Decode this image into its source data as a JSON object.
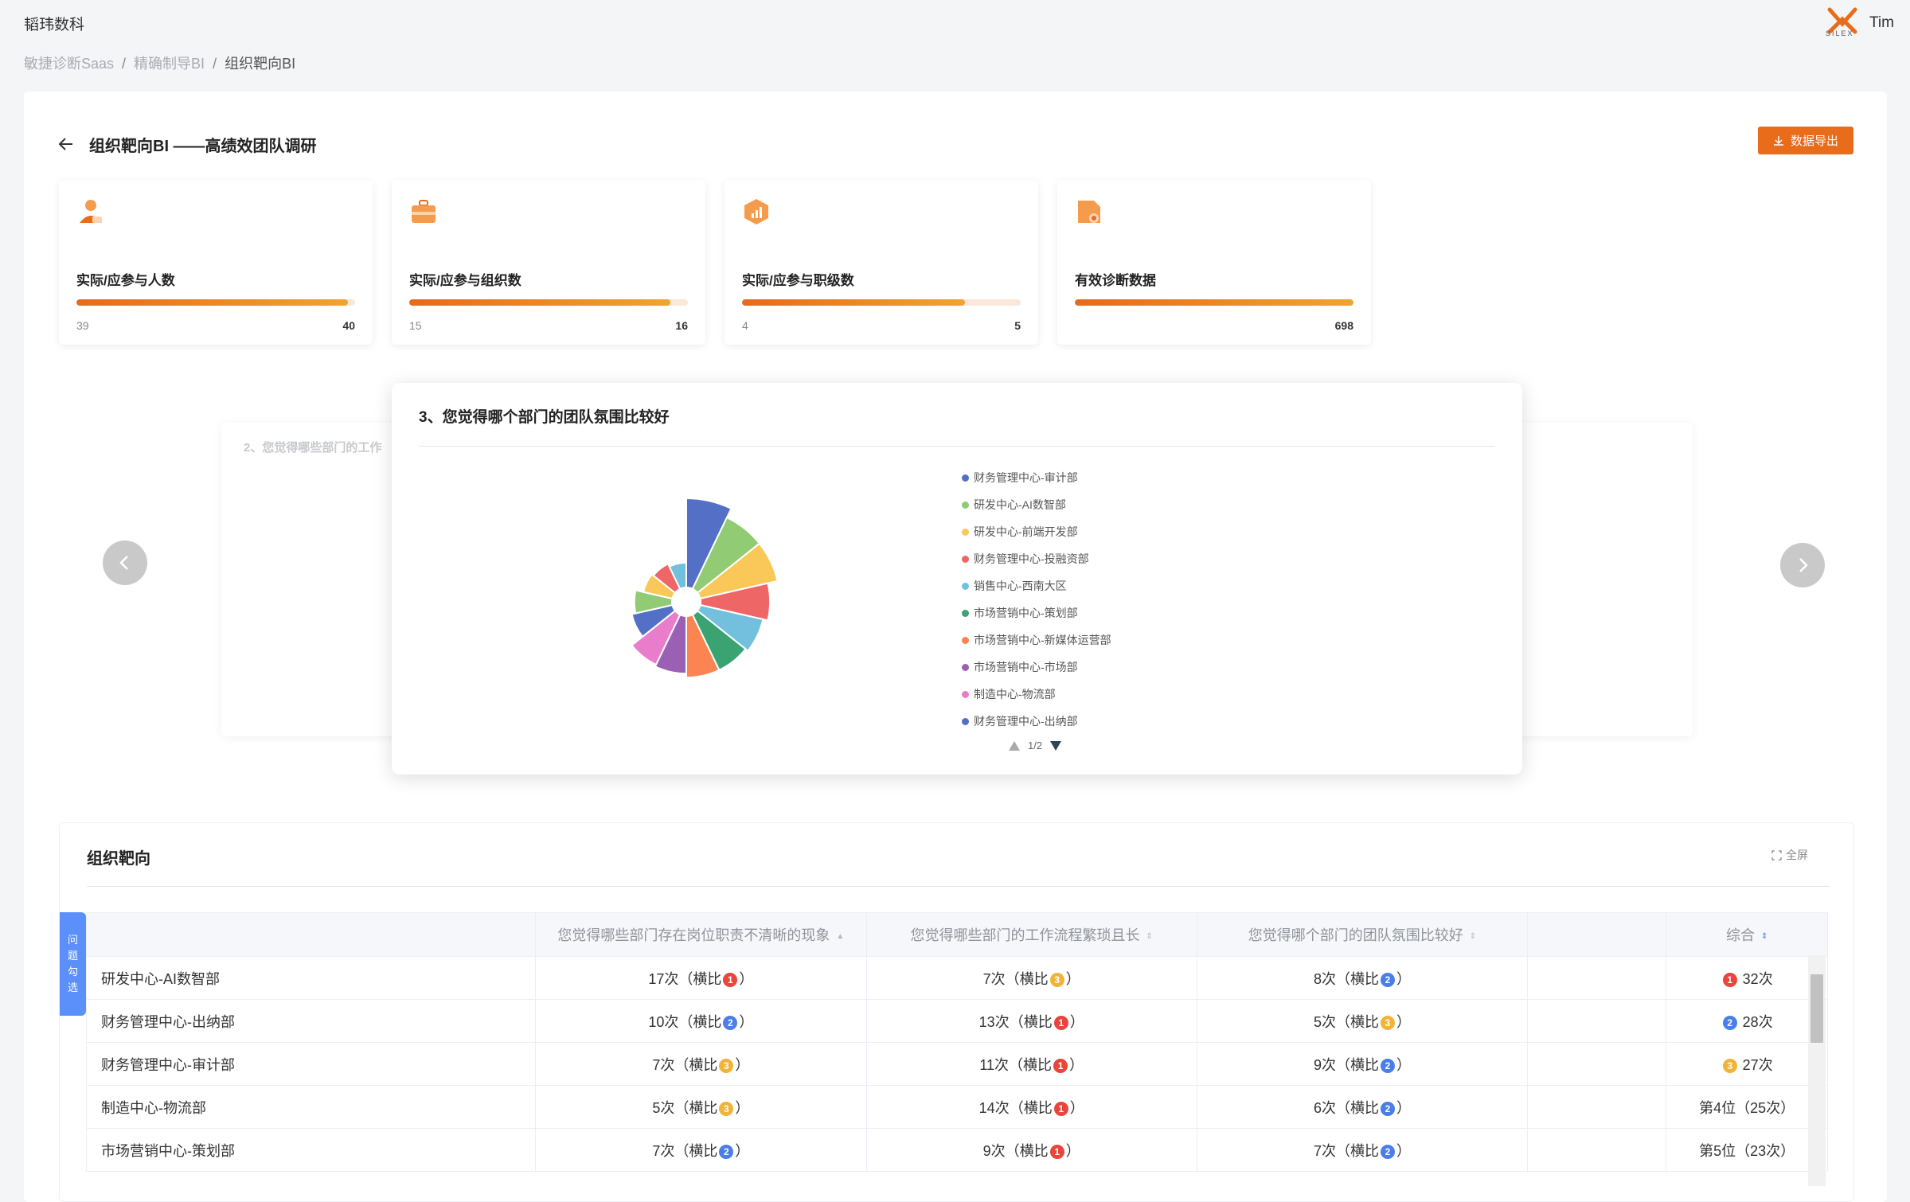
{
  "header": {
    "brand": "韬玮数科",
    "breadcrumb": [
      "敏捷诊断Saas",
      "精确制导BI",
      "组织靶向BI"
    ],
    "logo_text": "SILEX",
    "user_name": "Tim"
  },
  "page": {
    "title": "组织靶向BI ——高绩效团队调研",
    "export_label": "数据导出"
  },
  "stats": [
    {
      "label": "实际/应参与人数",
      "actual": "39",
      "total": "40",
      "progress": 0.975,
      "icon": "user-icon"
    },
    {
      "label": "实际/应参与组织数",
      "actual": "15",
      "total": "16",
      "progress": 0.9375,
      "icon": "briefcase-icon"
    },
    {
      "label": "实际/应参与职级数",
      "actual": "4",
      "total": "5",
      "progress": 0.8,
      "icon": "level-icon"
    },
    {
      "label": "有效诊断数据",
      "actual": "",
      "total": "698",
      "progress": 1.0,
      "icon": "data-icon"
    }
  ],
  "carousel": {
    "back_card_title": "2、您觉得哪些部门的工作",
    "main_card_title": "3、您觉得哪个部门的团队氛围比较好",
    "pager": "1/2"
  },
  "chart_data": {
    "type": "pie",
    "variant": "rose",
    "series": [
      {
        "name": "财务管理中心-审计部",
        "color": "#5470c6"
      },
      {
        "name": "研发中心-AI数智部",
        "color": "#91cc75"
      },
      {
        "name": "研发中心-前端开发部",
        "color": "#fac858"
      },
      {
        "name": "财务管理中心-投融资部",
        "color": "#ee6666"
      },
      {
        "name": "销售中心-西南大区",
        "color": "#73c0de"
      },
      {
        "name": "市场营销中心-策划部",
        "color": "#3ba272"
      },
      {
        "name": "市场营销中心-新媒体运营部",
        "color": "#fc8452"
      },
      {
        "name": "市场营销中心-市场部",
        "color": "#9a60b4"
      },
      {
        "name": "制造中心-物流部",
        "color": "#ea7ccc"
      },
      {
        "name": "财务管理中心-出纳部",
        "color": "#5470c6"
      }
    ],
    "slices": [
      {
        "color": "#5470c6",
        "value": 9
      },
      {
        "color": "#91cc75",
        "value": 8
      },
      {
        "color": "#fac858",
        "value": 8
      },
      {
        "color": "#ee6666",
        "value": 7
      },
      {
        "color": "#73c0de",
        "value": 6.5
      },
      {
        "color": "#3ba272",
        "value": 6.2
      },
      {
        "color": "#fc8452",
        "value": 6.2
      },
      {
        "color": "#9a60b4",
        "value": 5.8
      },
      {
        "color": "#ea7ccc",
        "value": 5.6
      },
      {
        "color": "#5470c6",
        "value": 4.2
      },
      {
        "color": "#91cc75",
        "value": 3.8
      },
      {
        "color": "#fac858",
        "value": 3
      },
      {
        "color": "#ee6666",
        "value": 2.8
      },
      {
        "color": "#73c0de",
        "value": 2.5
      }
    ]
  },
  "table": {
    "section_title": "组织靶向",
    "fullscreen_label": "全屏",
    "side_tab": "问题勾选",
    "columns": [
      "",
      "您觉得哪些部门存在岗位职责不清晰的现象",
      "您觉得哪些部门的工作流程繁琐且长",
      "您觉得哪个部门的团队氛围比较好",
      "",
      "综合"
    ],
    "rows": [
      {
        "dept": "研发中心-AI数智部",
        "c1": "17次（横比",
        "r1": "1",
        "c2": "7次（横比",
        "r2": "3",
        "c3": "8次（横比",
        "r3": "2",
        "overall_medal": "1",
        "overall": "32次"
      },
      {
        "dept": "财务管理中心-出纳部",
        "c1": "10次（横比",
        "r1": "2",
        "c2": "13次（横比",
        "r2": "1",
        "c3": "5次（横比",
        "r3": "3",
        "overall_medal": "2",
        "overall": "28次"
      },
      {
        "dept": "财务管理中心-审计部",
        "c1": "7次（横比",
        "r1": "3",
        "c2": "11次（横比",
        "r2": "1",
        "c3": "9次（横比",
        "r3": "2",
        "overall_medal": "3",
        "overall": "27次"
      },
      {
        "dept": "制造中心-物流部",
        "c1": "5次（横比",
        "r1": "3",
        "c2": "14次（横比",
        "r2": "1",
        "c3": "6次（横比",
        "r3": "2",
        "overall_medal": "",
        "overall": "第4位（25次）"
      },
      {
        "dept": "市场营销中心-策划部",
        "c1": "7次（横比",
        "r1": "2",
        "c2": "9次（横比",
        "r2": "1",
        "c3": "7次（横比",
        "r3": "2",
        "overall_medal": "",
        "overall": "第5位（23次）"
      }
    ],
    "close_paren": "）"
  },
  "colors": {
    "accent": "#e86c19",
    "progress_start": "#e46b1e",
    "progress_end": "#f0a332",
    "side_tab": "#5b8ff9"
  }
}
